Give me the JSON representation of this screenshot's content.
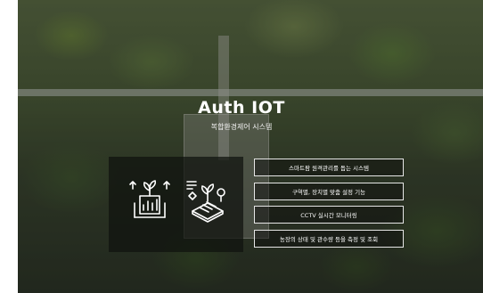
{
  "hero": {
    "title": "Auth IOT",
    "subtitle": "복합환경제어 시스템"
  },
  "icons": [
    "growth-chart-icon",
    "smart-farm-icon"
  ],
  "features": [
    "스마트팜 원격관리를 돕는 시스템",
    "구역별, 장치별 맞춤 설정 기능",
    "CCTV 실시간 모니터링",
    "농장의 상태 및 관수량 등을 측정 및 조회"
  ],
  "colors": {
    "text": "#ffffff",
    "button_border": "#e6e6e6",
    "panel": "#0f120e"
  }
}
